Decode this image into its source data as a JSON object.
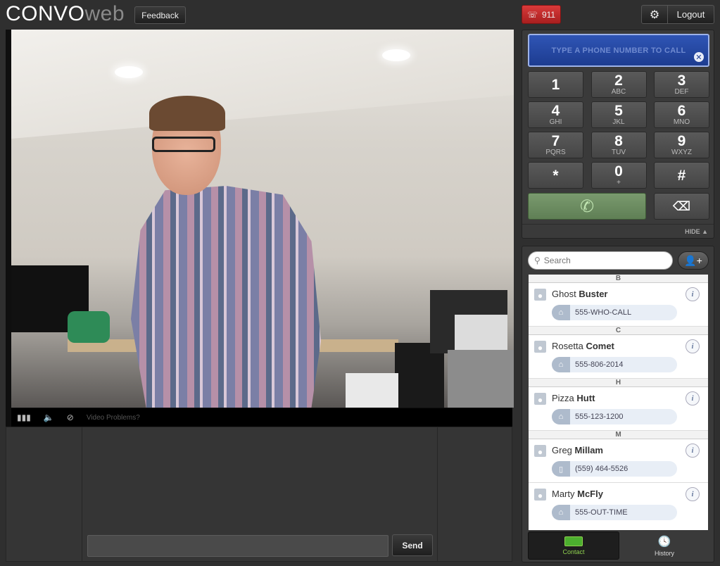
{
  "header": {
    "logo_part1": "CONVO",
    "logo_part2": "web",
    "feedback_label": "Feedback",
    "emergency_label": "911",
    "logout_label": "Logout"
  },
  "video": {
    "problems_label": "Video Problems?"
  },
  "chat": {
    "send_label": "Send",
    "input_value": ""
  },
  "dialer": {
    "placeholder": "TYPE A PHONE NUMBER TO CALL",
    "keys": [
      {
        "digit": "1",
        "letters": ""
      },
      {
        "digit": "2",
        "letters": "ABC"
      },
      {
        "digit": "3",
        "letters": "DEF"
      },
      {
        "digit": "4",
        "letters": "GHI"
      },
      {
        "digit": "5",
        "letters": "JKL"
      },
      {
        "digit": "6",
        "letters": "MNO"
      },
      {
        "digit": "7",
        "letters": "PQRS"
      },
      {
        "digit": "8",
        "letters": "TUV"
      },
      {
        "digit": "9",
        "letters": "WXYZ"
      },
      {
        "digit": "*",
        "letters": ""
      },
      {
        "digit": "0",
        "letters": "+"
      },
      {
        "digit": "#",
        "letters": ""
      }
    ],
    "hide_label": "HIDE ▲"
  },
  "contacts": {
    "search_placeholder": "Search",
    "groups": [
      {
        "letter": "B",
        "contacts": [
          {
            "first": "Ghost",
            "last": "Buster",
            "number": "555-WHO-CALL",
            "type": "home"
          }
        ]
      },
      {
        "letter": "C",
        "contacts": [
          {
            "first": "Rosetta",
            "last": "Comet",
            "number": "555-806-2014",
            "type": "home"
          }
        ]
      },
      {
        "letter": "H",
        "contacts": [
          {
            "first": "Pizza",
            "last": "Hutt",
            "number": "555-123-1200",
            "type": "home"
          }
        ]
      },
      {
        "letter": "M",
        "contacts": [
          {
            "first": "Greg",
            "last": "Millam",
            "number": "(559) 464-5526",
            "type": "mobile"
          },
          {
            "first": "Marty",
            "last": "McFly",
            "number": "555-OUT-TIME",
            "type": "home"
          }
        ]
      }
    ],
    "tabs": [
      {
        "label": "Contact",
        "active": true
      },
      {
        "label": "History",
        "active": false
      }
    ]
  }
}
